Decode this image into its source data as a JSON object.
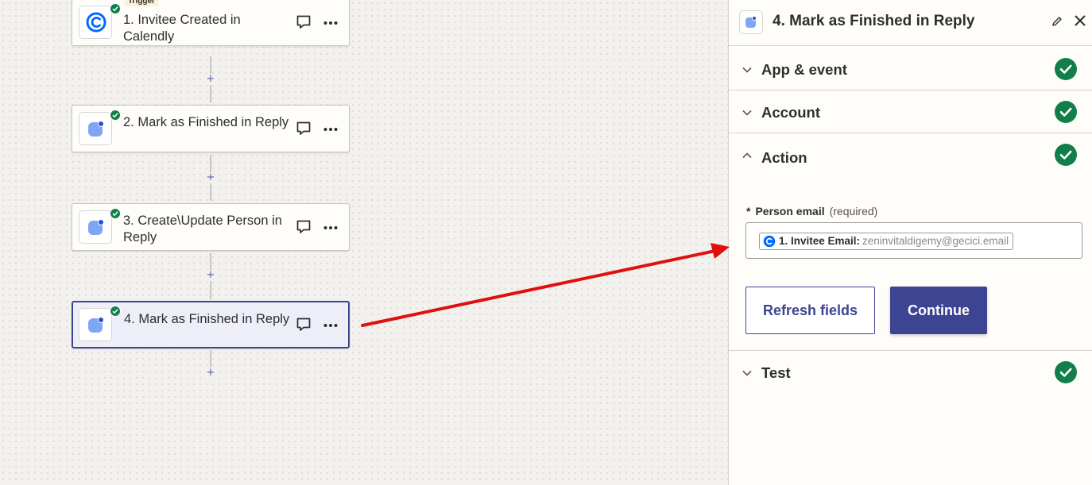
{
  "canvas": {
    "steps": [
      {
        "title": "1. Invitee Created in Calendly",
        "badge": "Trigger",
        "app_icon": "calendly-logo",
        "status_icon": "check-icon"
      },
      {
        "title": "2. Mark as Finished in Reply",
        "app_icon": "reply-logo",
        "status_icon": "check-icon"
      },
      {
        "title": "3. Create\\Update Person in Reply",
        "app_icon": "reply-logo",
        "status_icon": "check-icon"
      },
      {
        "title": "4. Mark as Finished in Reply",
        "app_icon": "reply-logo",
        "status_icon": "check-icon",
        "selected": true
      }
    ],
    "add_step_label": "+",
    "icons": {
      "comment": "comment-icon",
      "more": "more-options-icon"
    }
  },
  "panel": {
    "title": "4. Mark as Finished in Reply",
    "header_icons": [
      "pencil-icon",
      "close-icon"
    ],
    "sections": {
      "app_event": {
        "label": "App & event",
        "status": "complete"
      },
      "account": {
        "label": "Account",
        "status": "complete"
      },
      "action": {
        "label": "Action",
        "status": "complete",
        "expanded": true
      },
      "test": {
        "label": "Test",
        "status": "complete"
      }
    },
    "field": {
      "required_mark": "*",
      "label": "Person email",
      "required_text": "(required)",
      "pill_key": "1. Invitee Email:",
      "pill_value": "zeninvitaldigemy@gecici.email"
    },
    "buttons": {
      "refresh": "Refresh fields",
      "continue": "Continue"
    }
  },
  "colors": {
    "brand": "#3d4592",
    "success": "#127f4b",
    "annotation_arrow": "#e01010",
    "calendly_blue": "#006bff"
  }
}
